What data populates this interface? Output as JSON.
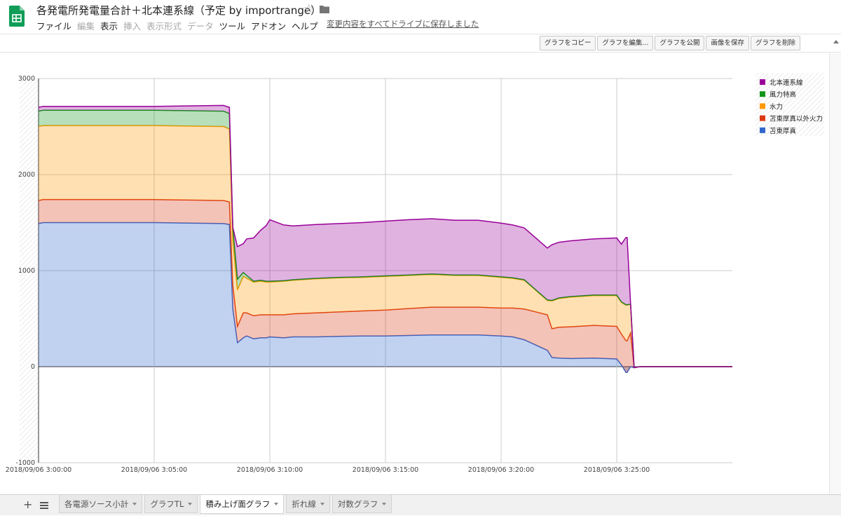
{
  "doc": {
    "title": "各発電所発電量合計＋北本連系線（予定 by importrange）",
    "save_status": "変更内容をすべてドライブに保存しました"
  },
  "menu": [
    {
      "label": "ファイル",
      "enabled": true
    },
    {
      "label": "編集",
      "enabled": false
    },
    {
      "label": "表示",
      "enabled": true
    },
    {
      "label": "挿入",
      "enabled": false
    },
    {
      "label": "表示形式",
      "enabled": false
    },
    {
      "label": "データ",
      "enabled": false
    },
    {
      "label": "ツール",
      "enabled": true
    },
    {
      "label": "アドオン",
      "enabled": true
    },
    {
      "label": "ヘルプ",
      "enabled": true
    }
  ],
  "toolbar": {
    "copy_chart": "グラフをコピー",
    "edit_chart": "グラフを編集...",
    "publish_chart": "グラフを公開",
    "save_image": "画像を保存",
    "delete_chart": "グラフを削除"
  },
  "sheets": [
    {
      "label": "各電源ソース小計",
      "active": false
    },
    {
      "label": "グラフTL",
      "active": false
    },
    {
      "label": "積み上げ面グラフ",
      "active": true
    },
    {
      "label": "折れ線",
      "active": false
    },
    {
      "label": "対数グラフ",
      "active": false
    }
  ],
  "colors": {
    "brand_green": "#0f9d58",
    "grid": "#cccccc"
  },
  "chart_data": {
    "type": "area",
    "stacked": true,
    "ylim": [
      -1000,
      3000
    ],
    "yticks": [
      -1000,
      0,
      1000,
      2000,
      3000
    ],
    "xticks": [
      {
        "t": 0,
        "label": "2018/09/06 3:00:00"
      },
      {
        "t": 5,
        "label": "2018/09/06 3:05:00"
      },
      {
        "t": 10,
        "label": "2018/09/06 3:10:00"
      },
      {
        "t": 15,
        "label": "2018/09/06 3:15:00"
      },
      {
        "t": 20,
        "label": "2018/09/06 3:20:00"
      },
      {
        "t": 25,
        "label": "2018/09/06 3:25:00"
      }
    ],
    "xlim": [
      0,
      30
    ],
    "grid": true,
    "legend_position": "right",
    "x": [
      0,
      0.2,
      3,
      5,
      8,
      8.25,
      8.4,
      8.6,
      8.85,
      9,
      9.3,
      9.6,
      9.85,
      10,
      10.6,
      11,
      12,
      13,
      14,
      15,
      16,
      17,
      18,
      19,
      20,
      20.5,
      21,
      22,
      22.2,
      22.5,
      23,
      24,
      25,
      25.2,
      25.4,
      25.45,
      25.6,
      25.75,
      26,
      30
    ],
    "series": [
      {
        "name": "苫東厚真",
        "color": "#3366cc",
        "values": [
          1490,
          1500,
          1500,
          1500,
          1490,
          1480,
          600,
          250,
          300,
          320,
          290,
          300,
          300,
          310,
          300,
          310,
          310,
          315,
          320,
          320,
          325,
          330,
          330,
          330,
          320,
          310,
          280,
          170,
          95,
          90,
          85,
          90,
          80,
          20,
          -60,
          -60,
          0,
          -10,
          0,
          0
        ]
      },
      {
        "name": "苫東厚真以外火力",
        "color": "#dc3912",
        "values": [
          240,
          240,
          240,
          240,
          240,
          235,
          250,
          170,
          260,
          240,
          240,
          240,
          240,
          230,
          240,
          240,
          250,
          255,
          260,
          270,
          280,
          290,
          290,
          290,
          290,
          300,
          320,
          370,
          300,
          320,
          330,
          340,
          340,
          320,
          330,
          330,
          350,
          0,
          0,
          0
        ]
      },
      {
        "name": "水力",
        "color": "#ff9900",
        "values": [
          770,
          770,
          770,
          770,
          770,
          760,
          460,
          380,
          380,
          360,
          350,
          350,
          340,
          340,
          350,
          350,
          355,
          355,
          350,
          350,
          345,
          340,
          330,
          330,
          320,
          310,
          300,
          150,
          290,
          300,
          310,
          310,
          320,
          330,
          370,
          370,
          300,
          0,
          0,
          0
        ]
      },
      {
        "name": "風力特高",
        "color": "#109618",
        "values": [
          160,
          160,
          160,
          160,
          160,
          160,
          140,
          110,
          40,
          30,
          10,
          10,
          10,
          10,
          5,
          5,
          5,
          5,
          5,
          5,
          5,
          5,
          5,
          5,
          5,
          5,
          5,
          5,
          5,
          5,
          5,
          5,
          5,
          5,
          5,
          5,
          0,
          0,
          0,
          0
        ]
      },
      {
        "name": "北本連系線",
        "color": "#990099",
        "values": [
          40,
          40,
          40,
          40,
          60,
          65,
          0,
          340,
          300,
          380,
          450,
          520,
          580,
          640,
          580,
          560,
          560,
          560,
          565,
          570,
          575,
          575,
          570,
          570,
          560,
          550,
          540,
          540,
          580,
          580,
          580,
          585,
          595,
          600,
          700,
          700,
          0,
          0,
          0,
          0
        ]
      }
    ]
  }
}
